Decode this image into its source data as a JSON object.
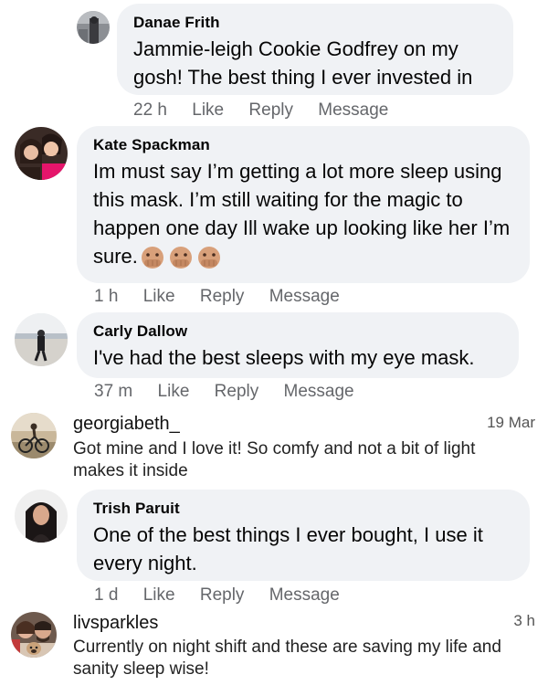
{
  "comments": [
    {
      "kind": "facebook",
      "author": "Danae Frith",
      "text": "Jammie-leigh Cookie Godfrey on my gosh! The best thing I ever invested in",
      "time": "22 h",
      "like": "Like",
      "reply": "Reply",
      "message": "Message",
      "avatar_icon": "person-at-door-avatar"
    },
    {
      "kind": "facebook",
      "author": "Kate Spackman",
      "text": "Im must say I’m getting a lot more sleep using this mask. I’m still waiting for the magic to happen one day Ill wake up looking like her I’m sure.",
      "emoji_icon": "hand-over-mouth-emoji",
      "emoji_count": 3,
      "time": "1 h",
      "like": "Like",
      "reply": "Reply",
      "message": "Message",
      "avatar_icon": "two-women-avatar"
    },
    {
      "kind": "facebook",
      "author": "Carly Dallow",
      "text": "I've had the best sleeps with my eye mask.",
      "time": "37 m",
      "like": "Like",
      "reply": "Reply",
      "message": "Message",
      "avatar_icon": "person-on-beach-avatar"
    },
    {
      "kind": "instagram",
      "author": "georgiabeth_",
      "date": "19 Mar",
      "text": "Got mine and I love it! So comfy and not a bit of light makes it inside",
      "avatar_icon": "cyclist-avatar"
    },
    {
      "kind": "facebook",
      "author": "Trish Paruit",
      "text": "One of the best things I ever bought, I use it every night.",
      "time": "1 d",
      "like": "Like",
      "reply": "Reply",
      "message": "Message",
      "avatar_icon": "dark-hair-woman-avatar"
    },
    {
      "kind": "instagram",
      "author": "livsparkles",
      "date": "3 h",
      "text": "Currently on night shift and these are saving my life and sanity sleep wise!",
      "avatar_icon": "couple-with-dog-avatar"
    }
  ],
  "colors": {
    "bubble": "#f0f2f5",
    "meta": "#65676b",
    "text": "#050505"
  }
}
